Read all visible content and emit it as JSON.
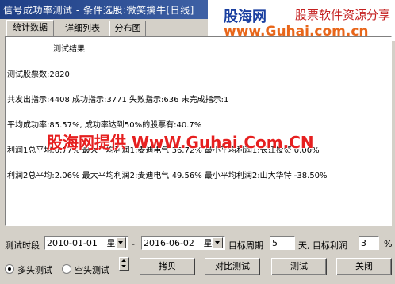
{
  "window": {
    "title": "信号成功率测试 - 条件选股:微笑擒牛[日线]"
  },
  "banner": {
    "brand": "股海网",
    "tagline": "股票软件资源分享",
    "url": "www.Guhai.com.cn"
  },
  "tabs": [
    {
      "label": "统计数据",
      "active": true
    },
    {
      "label": "详细列表",
      "active": false
    },
    {
      "label": "分布图",
      "active": false
    }
  ],
  "results": {
    "heading": "测试结果",
    "stock_count": "测试股票数:2820",
    "signals": "共发出指示:4408 成功指示:3771 失败指示:636 未完成指示:1",
    "success_rate": "平均成功率:85.57%, 成功率达到50%的股票有:40.7%",
    "profit1": "利润1总平均:0.77% 最大平均利润1:麦迪电气 36.72% 最小平均利润1:长江投资 0.00%",
    "profit2": "利润2总平均:2.06% 最大平均利润2:麦迪电气 49.56% 最小平均利润2:山大华特 -38.50%"
  },
  "watermark": "股海网提供 WwW.Guhai.Com.CN",
  "form": {
    "period_label": "测试时段",
    "start_date": "2010-01-01",
    "start_weekday": "星期",
    "dash": "-",
    "end_date": "2016-06-02",
    "end_weekday": "星期",
    "target_period_label": "目标周期",
    "target_period_value": "5",
    "target_profit_label": "天, 目标利润",
    "target_profit_value": "3",
    "percent": "%"
  },
  "modes": [
    {
      "label": "多头测试",
      "selected": true
    },
    {
      "label": "空头测试",
      "selected": false
    }
  ],
  "buttons": {
    "copy": "拷贝",
    "compare": "对比测试",
    "test": "测试",
    "close": "关闭"
  }
}
